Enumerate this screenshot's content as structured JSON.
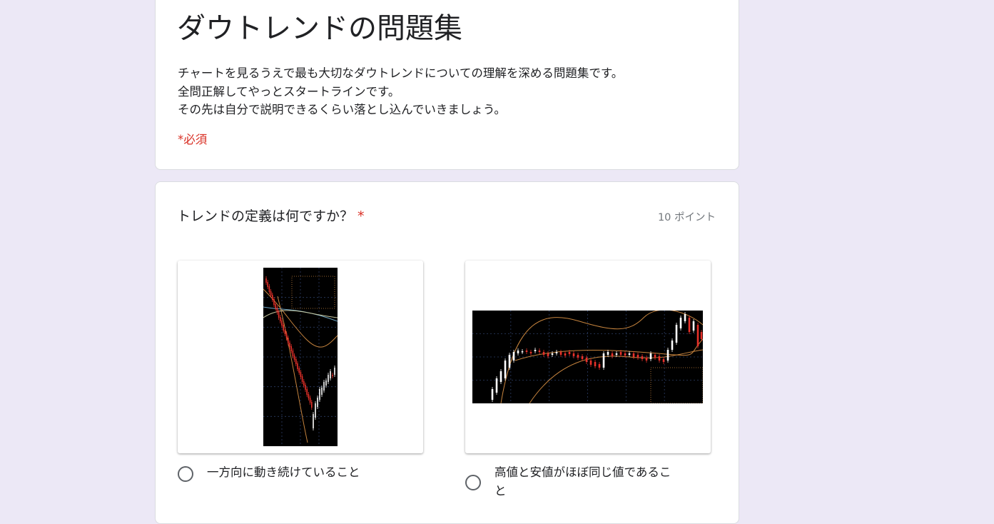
{
  "form": {
    "title": "ダウトレンドの問題集",
    "description": [
      "チャートを見るうえで最も大切なダウトレンドについての理解を深める問題集です。",
      "全問正解してやっとスタートラインです。",
      "その先は自分で説明できるくらい落とし込んでいきましょう。"
    ],
    "required_note": "*必須"
  },
  "question": {
    "title": "トレンドの定義は何ですか？",
    "required_mark": "*",
    "points": "10 ポイント",
    "options": [
      {
        "label": "一方向に動き続けていること",
        "image": "candlestick-chart-downtrend"
      },
      {
        "label": "高値と安値がほぼ同じ値であること",
        "image": "candlestick-chart-range"
      }
    ]
  },
  "colors": {
    "background": "#ece8f6",
    "accent": "#8f86c8",
    "required": "#d93025",
    "bearish_candle": "#e8312a",
    "bullish_candle": "#ffffff",
    "chart_background": "#000000",
    "indicator_line": "#c7843e"
  }
}
